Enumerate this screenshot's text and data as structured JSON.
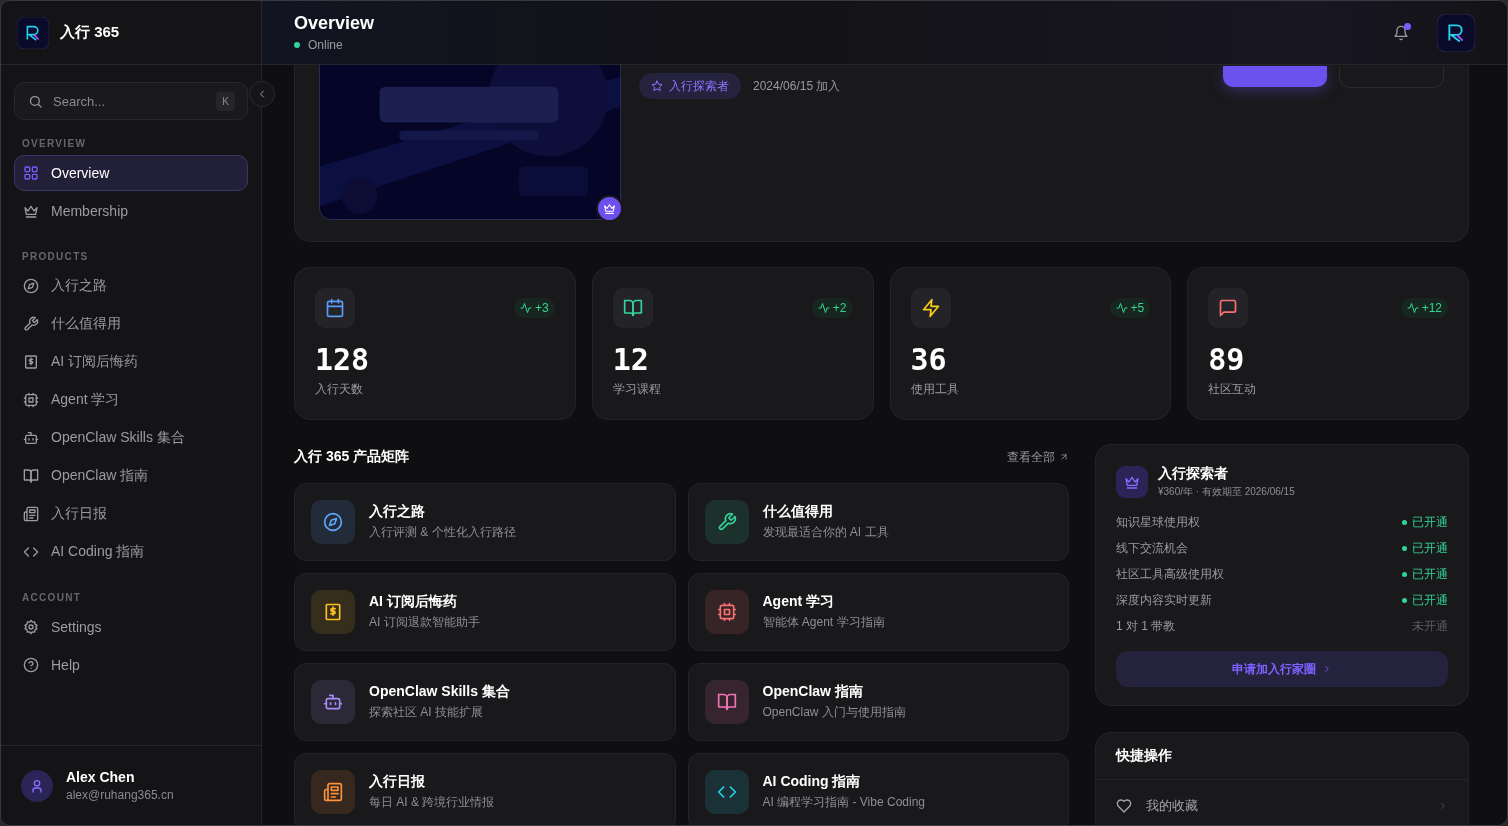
{
  "sidebar": {
    "brand": "入行 365",
    "search": {
      "placeholder": "Search...",
      "shortcut": "K"
    },
    "sections": [
      {
        "title": "OVERVIEW",
        "items": [
          {
            "label": "Overview",
            "selected": true
          },
          {
            "label": "Membership",
            "selected": false
          }
        ]
      },
      {
        "title": "PRODUCTS",
        "items": [
          {
            "label": "入行之路",
            "selected": false
          },
          {
            "label": "什么值得用",
            "selected": false
          },
          {
            "label": "AI 订阅后悔药",
            "selected": false
          },
          {
            "label": "Agent 学习",
            "selected": false
          },
          {
            "label": "OpenClaw Skills 集合",
            "selected": false
          },
          {
            "label": "OpenClaw 指南",
            "selected": false
          },
          {
            "label": "入行日报",
            "selected": false
          },
          {
            "label": "AI Coding 指南",
            "selected": false
          }
        ]
      },
      {
        "title": "ACCOUNT",
        "items": [
          {
            "label": "Settings",
            "selected": false
          },
          {
            "label": "Help",
            "selected": false
          }
        ]
      }
    ],
    "user": {
      "name": "Alex Chen",
      "email": "alex@ruhang365.cn"
    }
  },
  "header": {
    "title": "Overview",
    "status": "Online",
    "online": true,
    "unread": true
  },
  "profile": {
    "tag": "入行探索者",
    "joined": "2024/06/15 加入",
    "buttons": [
      {
        "kind": "primary"
      },
      {
        "kind": "secondary"
      }
    ]
  },
  "stats": [
    {
      "value": "128",
      "label": "入行天数",
      "delta": "+3",
      "color": "#5b9cf6"
    },
    {
      "value": "12",
      "label": "学习课程",
      "delta": "+2",
      "color": "#34d399"
    },
    {
      "value": "36",
      "label": "使用工具",
      "delta": "+5",
      "color": "#facc15"
    },
    {
      "value": "89",
      "label": "社区互动",
      "delta": "+12",
      "color": "#f87171"
    }
  ],
  "products": {
    "title": "入行 365 产品矩阵",
    "view_all": "查看全部",
    "items": [
      {
        "title": "入行之路",
        "subtitle": "入行评测 & 个性化入行路径",
        "color": "#60a5fa"
      },
      {
        "title": "什么值得用",
        "subtitle": "发现最适合你的 AI 工具",
        "color": "#34d399"
      },
      {
        "title": "AI 订阅后悔药",
        "subtitle": "AI 订阅退款智能助手",
        "color": "#fbbf24"
      },
      {
        "title": "Agent 学习",
        "subtitle": "智能体 Agent 学习指南",
        "color": "#f87171"
      },
      {
        "title": "OpenClaw Skills 集合",
        "subtitle": "探索社区 AI 技能扩展",
        "color": "#a78bfa"
      },
      {
        "title": "OpenClaw 指南",
        "subtitle": "OpenClaw 入门与使用指南",
        "color": "#f472b6"
      },
      {
        "title": "入行日报",
        "subtitle": "每日 AI & 跨境行业情报",
        "color": "#fb923c"
      },
      {
        "title": "AI Coding 指南",
        "subtitle": "AI 编程学习指南 - Vibe Coding",
        "color": "#22d3ee"
      }
    ]
  },
  "membership": {
    "title": "入行探索者",
    "meta": "¥360/年 · 有效期至 2026/06/15",
    "benefits": [
      {
        "label": "知识星球使用权",
        "status": "已开通",
        "enabled": true
      },
      {
        "label": "线下交流机会",
        "status": "已开通",
        "enabled": true
      },
      {
        "label": "社区工具高级使用权",
        "status": "已开通",
        "enabled": true
      },
      {
        "label": "深度内容实时更新",
        "status": "已开通",
        "enabled": true
      },
      {
        "label": "1 对 1 带教",
        "status": "未开通",
        "enabled": false
      }
    ],
    "action": "申请加入行家圈"
  },
  "quick_actions": {
    "title": "快捷操作",
    "items": [
      {
        "label": "我的收藏"
      }
    ]
  }
}
